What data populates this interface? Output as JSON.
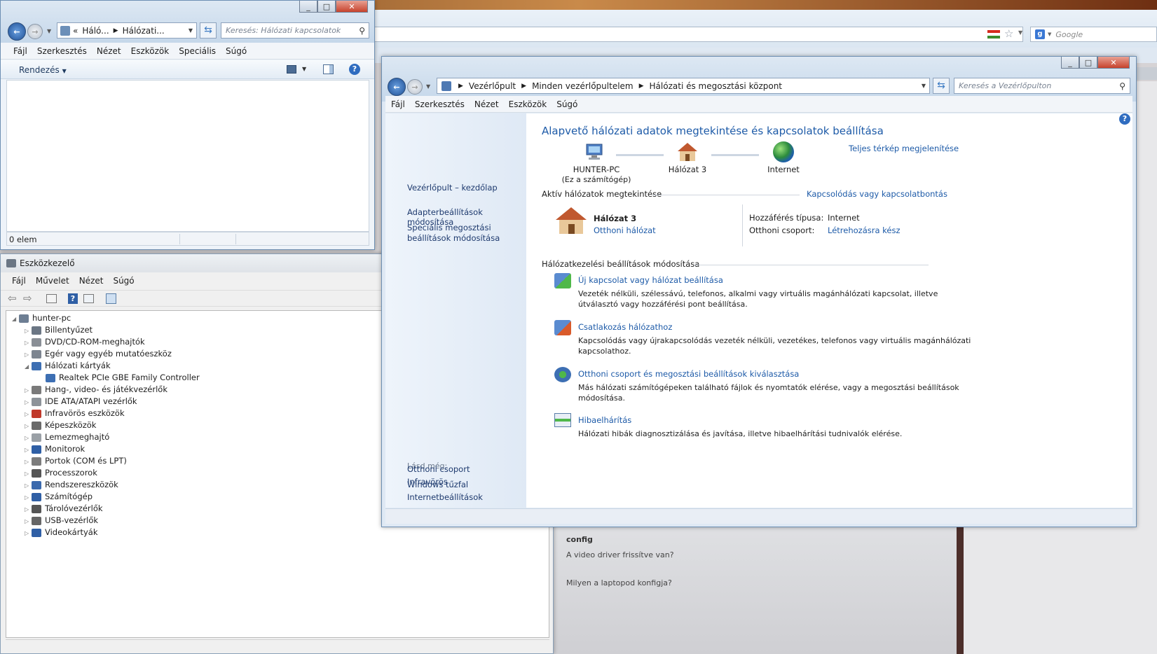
{
  "browser": {
    "search_placeholder": "Google",
    "bg_text": [
      "config",
      "A video driver frissítve van?",
      "Milyen a laptopod konfigja?"
    ]
  },
  "explorer": {
    "breadcrumb_prefix": "«",
    "breadcrumb": [
      "Háló...",
      "Hálózati..."
    ],
    "search_placeholder": "Keresés: Hálózati kapcsolatok",
    "menu": [
      "Fájl",
      "Szerkesztés",
      "Nézet",
      "Eszközök",
      "Speciális",
      "Súgó"
    ],
    "organize_label": "Rendezés",
    "status": "0 elem"
  },
  "devmgr": {
    "title": "Eszközkezelő",
    "menu": [
      "Fájl",
      "Művelet",
      "Nézet",
      "Súgó"
    ],
    "root": "hunter-pc",
    "items": [
      {
        "label": "Billentyűzet",
        "color": "#6b7684"
      },
      {
        "label": "DVD/CD-ROM-meghajtók",
        "color": "#8a8f96"
      },
      {
        "label": "Egér vagy egyéb mutatóeszköz",
        "color": "#7d8590"
      },
      {
        "label": "Hálózati kártyák",
        "color": "#3d6fb3"
      },
      {
        "label": "Hang-, video- és játékvezérlők",
        "color": "#7a7a7a"
      },
      {
        "label": "IDE ATA/ATAPI vezérlők",
        "color": "#8d9399"
      },
      {
        "label": "Infravörös eszközök",
        "color": "#c0392b"
      },
      {
        "label": "Képeszközök",
        "color": "#6a6a6a"
      },
      {
        "label": "Lemezmeghajtó",
        "color": "#9aa0a6"
      },
      {
        "label": "Monitorok",
        "color": "#2f5fa5"
      },
      {
        "label": "Portok (COM és LPT)",
        "color": "#7c7c7c"
      },
      {
        "label": "Processzorok",
        "color": "#555555"
      },
      {
        "label": "Rendszereszközök",
        "color": "#3a69ad"
      },
      {
        "label": "Számítógép",
        "color": "#2f5fa5"
      },
      {
        "label": "Tárolóvezérlők",
        "color": "#555555"
      },
      {
        "label": "USB-vezérlők",
        "color": "#666666"
      },
      {
        "label": "Videokártyák",
        "color": "#2f5fa5"
      }
    ],
    "child": "Realtek PCIe GBE Family Controller"
  },
  "netcenter": {
    "breadcrumb": [
      "Vezérlőpult",
      "Minden vezérlőpultelem",
      "Hálózati és megosztási központ"
    ],
    "search_placeholder": "Keresés a Vezérlőpulton",
    "menu": [
      "Fájl",
      "Szerkesztés",
      "Nézet",
      "Eszközök",
      "Súgó"
    ],
    "sidebar": {
      "home": "Vezérlőpult – kezdőlap",
      "adapter": "Adapterbeállítások módosítása",
      "advanced": "Speciális megosztási beállítások módosítása",
      "see_also": "Lásd még:",
      "see_also_links": [
        "Infravörös",
        "Internetbeállítások",
        "Otthoni csoport",
        "Windows tűzfal"
      ]
    },
    "heading": "Alapvető hálózati adatok megtekintése és kapcsolatok beállítása",
    "full_map": "Teljes térkép megjelenítése",
    "nodes": [
      {
        "name": "HUNTER-PC",
        "sub": "(Ez a számítógép)"
      },
      {
        "name": "Hálózat  3",
        "sub": ""
      },
      {
        "name": "Internet",
        "sub": ""
      }
    ],
    "active_title": "Aktív hálózatok megtekintése",
    "connect_link": "Kapcsolódás vagy kapcsolatbontás",
    "network_name": "Hálózat  3",
    "network_type": "Otthoni hálózat",
    "access_label": "Hozzáférés típusa:",
    "access_value": "Internet",
    "homegroup_label": "Otthoni csoport:",
    "homegroup_value": "Létrehozásra kész",
    "change_title": "Hálózatkezelési beállítások módosítása",
    "tasks": [
      {
        "title": "Új kapcsolat vagy hálózat beállítása",
        "desc1": "Vezeték nélküli, szélessávú, telefonos, alkalmi vagy virtuális magánhálózati kapcsolat, illetve",
        "desc2": "útválasztó vagy hozzáférési pont beállítása."
      },
      {
        "title": "Csatlakozás hálózathoz",
        "desc1": "Kapcsolódás vagy újrakapcsolódás vezeték nélküli, vezetékes, telefonos vagy virtuális magánhálózati",
        "desc2": "kapcsolathoz."
      },
      {
        "title": "Otthoni csoport és megosztási beállítások kiválasztása",
        "desc1": "Más hálózati számítógépeken található fájlok és nyomtatók elérése, vagy a megosztási beállítások",
        "desc2": "módosítása."
      },
      {
        "title": "Hibaelhárítás",
        "desc1": "Hálózati hibák diagnosztizálása és javítása, illetve hibaelhárítási tudnivalók elérése.",
        "desc2": ""
      }
    ]
  },
  "colors": {
    "link": "#1e5ba8",
    "sidebar_bg": "#e6eef8",
    "title_blue": "#1e5ba8"
  }
}
